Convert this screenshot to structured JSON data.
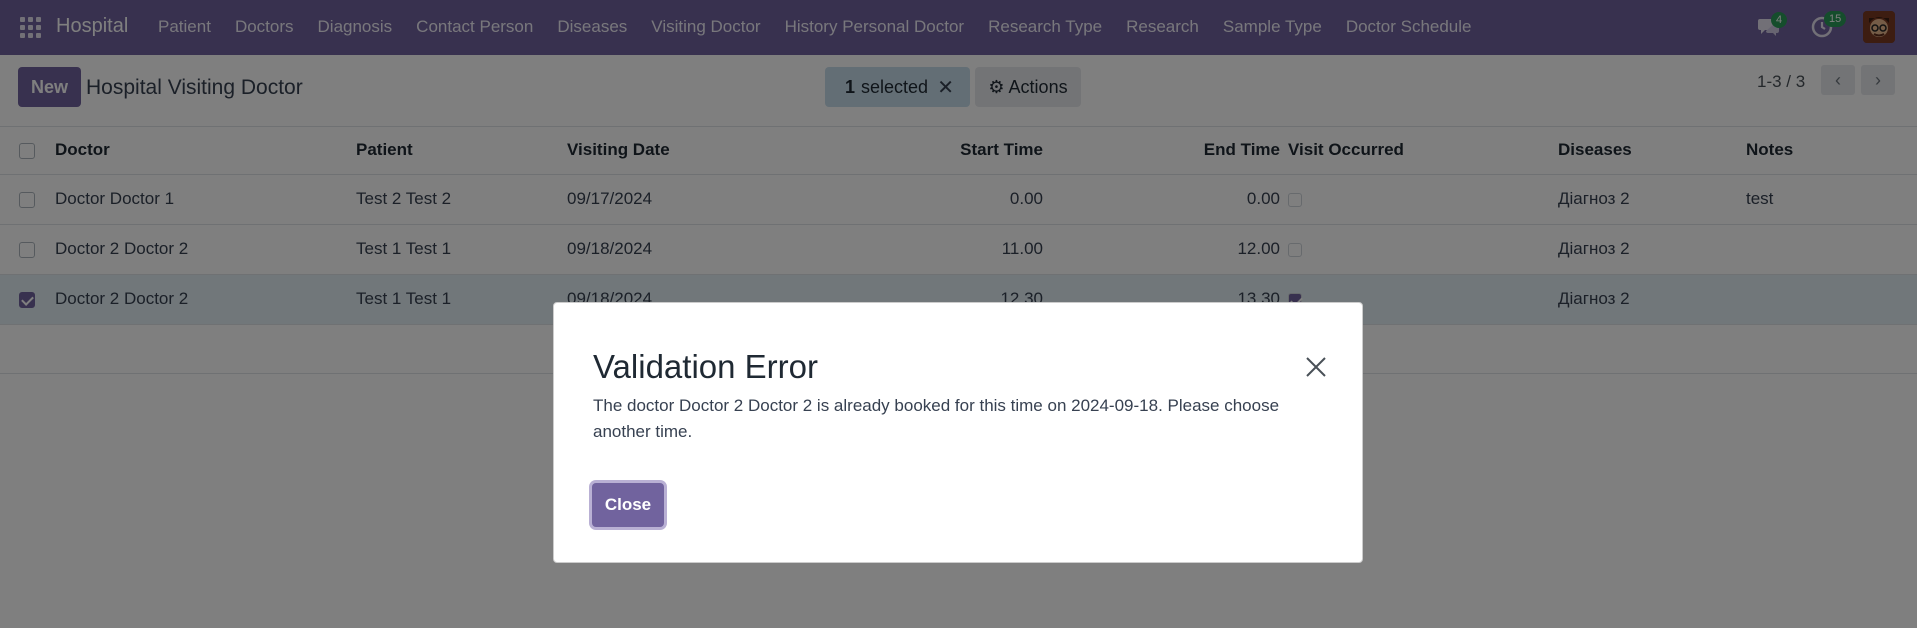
{
  "navbar": {
    "brand": "Hospital",
    "menu": [
      "Patient",
      "Doctors",
      "Diagnosis",
      "Contact Person",
      "Diseases",
      "Visiting Doctor",
      "History Personal Doctor",
      "Research Type",
      "Research",
      "Sample Type",
      "Doctor Schedule"
    ],
    "messages_count": "4",
    "activities_count": "15",
    "accent_color": "#71639e"
  },
  "control": {
    "new_label": "New",
    "title": "Hospital Visiting Doctor",
    "selected_count": "1",
    "selected_label": "selected",
    "actions_label": "Actions",
    "pager": "1-3 / 3"
  },
  "table": {
    "headers": {
      "doctor": "Doctor",
      "patient": "Patient",
      "visiting_date": "Visiting Date",
      "start_time": "Start Time",
      "end_time": "End Time",
      "visit_occurred": "Visit Occurred",
      "diseases": "Diseases",
      "notes": "Notes"
    },
    "rows": [
      {
        "doctor": "Doctor Doctor 1",
        "patient": "Test 2 Test 2",
        "visiting_date": "09/17/2024",
        "start_time": "0.00",
        "end_time": "0.00",
        "visit_occurred": false,
        "diseases": "Діагноз 2",
        "notes": "test",
        "selected": false
      },
      {
        "doctor": "Doctor 2 Doctor 2",
        "patient": "Test 1 Test 1",
        "visiting_date": "09/18/2024",
        "start_time": "11.00",
        "end_time": "12.00",
        "visit_occurred": false,
        "diseases": "Діагноз 2",
        "notes": "",
        "selected": false
      },
      {
        "doctor": "Doctor 2 Doctor 2",
        "patient": "Test 1 Test 1",
        "visiting_date": "09/18/2024",
        "start_time": "12.30",
        "end_time": "13.30",
        "visit_occurred": true,
        "diseases": "Діагноз 2",
        "notes": "",
        "selected": true
      }
    ]
  },
  "dialog": {
    "title": "Validation Error",
    "message": "The doctor Doctor 2 Doctor 2 is already booked for this time on 2024-09-18. Please choose another time.",
    "close_label": "Close"
  }
}
